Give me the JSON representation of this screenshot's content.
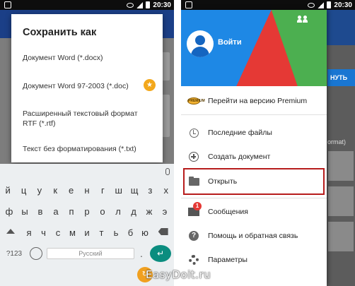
{
  "left_phone": {
    "status_time": "20:30",
    "dialog": {
      "title": "Сохранить как",
      "options": [
        "Документ Word (*.docx)",
        "Документ Word 97-2003 (*.doc)",
        "Расширенный текстовый формат RTF (*.rtf)",
        "Текст без форматирования (*.txt)"
      ]
    },
    "keyboard": {
      "row1": [
        "й",
        "ц",
        "у",
        "к",
        "е",
        "н",
        "г",
        "ш",
        "щ",
        "з",
        "х"
      ],
      "row2": [
        "ф",
        "ы",
        "в",
        "а",
        "п",
        "р",
        "о",
        "л",
        "д",
        "ж",
        "э"
      ],
      "row3": [
        "я",
        "ч",
        "с",
        "м",
        "и",
        "т",
        "ь",
        "б",
        "ю"
      ],
      "symbols_key": "?123",
      "space_label": "Русский",
      "dot_key": "."
    }
  },
  "right_phone": {
    "status_time": "20:30",
    "drawer": {
      "login_label": "Войти",
      "menu": [
        "Перейти на версию Premium",
        "Последние файлы",
        "Создать документ",
        "Открыть",
        "Сообщения",
        "Помощь и обратная связь",
        "Параметры"
      ],
      "messages_badge": "1",
      "premium_icon_text": "PREMIUM"
    },
    "background_app": {
      "button_text": "НУТЬ",
      "format_text": "ormat)"
    }
  },
  "watermark": "EasyDoit.ru",
  "colors": {
    "drawer_header_blue": "#1e88e5",
    "drawer_header_red": "#e53935",
    "drawer_header_green": "#4caf50",
    "highlight_box": "#b71c1c",
    "premium_badge": "#f3a81c"
  }
}
